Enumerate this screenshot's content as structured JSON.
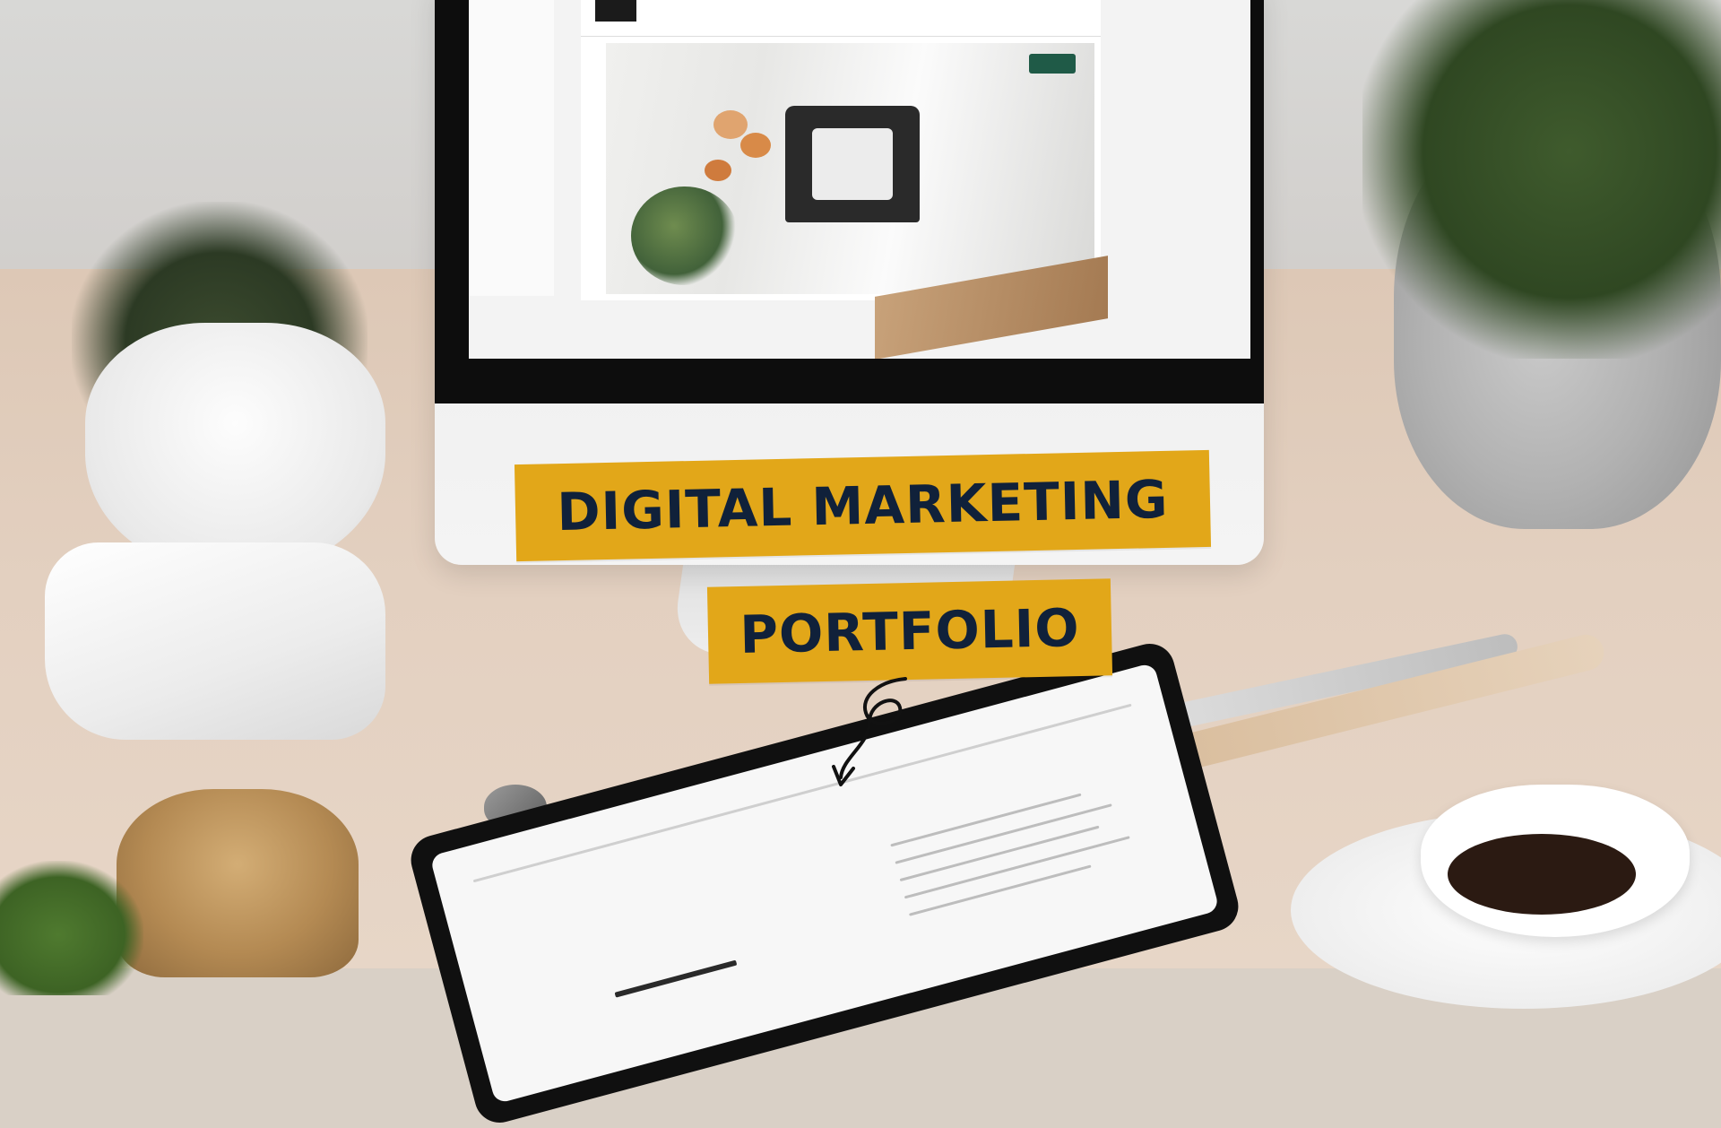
{
  "overlay": {
    "title_line_1": "DIGITAL MARKETING",
    "title_line_2": "PORTFOLIO"
  },
  "colors": {
    "highlight_box": "#e2a719",
    "title_text": "#10213a"
  }
}
